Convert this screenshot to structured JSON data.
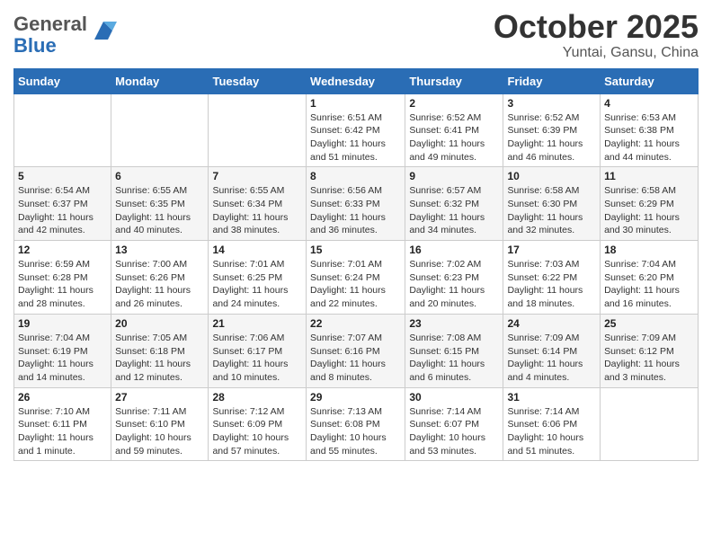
{
  "header": {
    "logo_general": "General",
    "logo_blue": "Blue",
    "month": "October 2025",
    "location": "Yuntai, Gansu, China"
  },
  "days_of_week": [
    "Sunday",
    "Monday",
    "Tuesday",
    "Wednesday",
    "Thursday",
    "Friday",
    "Saturday"
  ],
  "weeks": [
    [
      {
        "day": "",
        "info": ""
      },
      {
        "day": "",
        "info": ""
      },
      {
        "day": "",
        "info": ""
      },
      {
        "day": "1",
        "info": "Sunrise: 6:51 AM\nSunset: 6:42 PM\nDaylight: 11 hours\nand 51 minutes."
      },
      {
        "day": "2",
        "info": "Sunrise: 6:52 AM\nSunset: 6:41 PM\nDaylight: 11 hours\nand 49 minutes."
      },
      {
        "day": "3",
        "info": "Sunrise: 6:52 AM\nSunset: 6:39 PM\nDaylight: 11 hours\nand 46 minutes."
      },
      {
        "day": "4",
        "info": "Sunrise: 6:53 AM\nSunset: 6:38 PM\nDaylight: 11 hours\nand 44 minutes."
      }
    ],
    [
      {
        "day": "5",
        "info": "Sunrise: 6:54 AM\nSunset: 6:37 PM\nDaylight: 11 hours\nand 42 minutes."
      },
      {
        "day": "6",
        "info": "Sunrise: 6:55 AM\nSunset: 6:35 PM\nDaylight: 11 hours\nand 40 minutes."
      },
      {
        "day": "7",
        "info": "Sunrise: 6:55 AM\nSunset: 6:34 PM\nDaylight: 11 hours\nand 38 minutes."
      },
      {
        "day": "8",
        "info": "Sunrise: 6:56 AM\nSunset: 6:33 PM\nDaylight: 11 hours\nand 36 minutes."
      },
      {
        "day": "9",
        "info": "Sunrise: 6:57 AM\nSunset: 6:32 PM\nDaylight: 11 hours\nand 34 minutes."
      },
      {
        "day": "10",
        "info": "Sunrise: 6:58 AM\nSunset: 6:30 PM\nDaylight: 11 hours\nand 32 minutes."
      },
      {
        "day": "11",
        "info": "Sunrise: 6:58 AM\nSunset: 6:29 PM\nDaylight: 11 hours\nand 30 minutes."
      }
    ],
    [
      {
        "day": "12",
        "info": "Sunrise: 6:59 AM\nSunset: 6:28 PM\nDaylight: 11 hours\nand 28 minutes."
      },
      {
        "day": "13",
        "info": "Sunrise: 7:00 AM\nSunset: 6:26 PM\nDaylight: 11 hours\nand 26 minutes."
      },
      {
        "day": "14",
        "info": "Sunrise: 7:01 AM\nSunset: 6:25 PM\nDaylight: 11 hours\nand 24 minutes."
      },
      {
        "day": "15",
        "info": "Sunrise: 7:01 AM\nSunset: 6:24 PM\nDaylight: 11 hours\nand 22 minutes."
      },
      {
        "day": "16",
        "info": "Sunrise: 7:02 AM\nSunset: 6:23 PM\nDaylight: 11 hours\nand 20 minutes."
      },
      {
        "day": "17",
        "info": "Sunrise: 7:03 AM\nSunset: 6:22 PM\nDaylight: 11 hours\nand 18 minutes."
      },
      {
        "day": "18",
        "info": "Sunrise: 7:04 AM\nSunset: 6:20 PM\nDaylight: 11 hours\nand 16 minutes."
      }
    ],
    [
      {
        "day": "19",
        "info": "Sunrise: 7:04 AM\nSunset: 6:19 PM\nDaylight: 11 hours\nand 14 minutes."
      },
      {
        "day": "20",
        "info": "Sunrise: 7:05 AM\nSunset: 6:18 PM\nDaylight: 11 hours\nand 12 minutes."
      },
      {
        "day": "21",
        "info": "Sunrise: 7:06 AM\nSunset: 6:17 PM\nDaylight: 11 hours\nand 10 minutes."
      },
      {
        "day": "22",
        "info": "Sunrise: 7:07 AM\nSunset: 6:16 PM\nDaylight: 11 hours\nand 8 minutes."
      },
      {
        "day": "23",
        "info": "Sunrise: 7:08 AM\nSunset: 6:15 PM\nDaylight: 11 hours\nand 6 minutes."
      },
      {
        "day": "24",
        "info": "Sunrise: 7:09 AM\nSunset: 6:14 PM\nDaylight: 11 hours\nand 4 minutes."
      },
      {
        "day": "25",
        "info": "Sunrise: 7:09 AM\nSunset: 6:12 PM\nDaylight: 11 hours\nand 3 minutes."
      }
    ],
    [
      {
        "day": "26",
        "info": "Sunrise: 7:10 AM\nSunset: 6:11 PM\nDaylight: 11 hours\nand 1 minute."
      },
      {
        "day": "27",
        "info": "Sunrise: 7:11 AM\nSunset: 6:10 PM\nDaylight: 10 hours\nand 59 minutes."
      },
      {
        "day": "28",
        "info": "Sunrise: 7:12 AM\nSunset: 6:09 PM\nDaylight: 10 hours\nand 57 minutes."
      },
      {
        "day": "29",
        "info": "Sunrise: 7:13 AM\nSunset: 6:08 PM\nDaylight: 10 hours\nand 55 minutes."
      },
      {
        "day": "30",
        "info": "Sunrise: 7:14 AM\nSunset: 6:07 PM\nDaylight: 10 hours\nand 53 minutes."
      },
      {
        "day": "31",
        "info": "Sunrise: 7:14 AM\nSunset: 6:06 PM\nDaylight: 10 hours\nand 51 minutes."
      },
      {
        "day": "",
        "info": ""
      }
    ]
  ]
}
